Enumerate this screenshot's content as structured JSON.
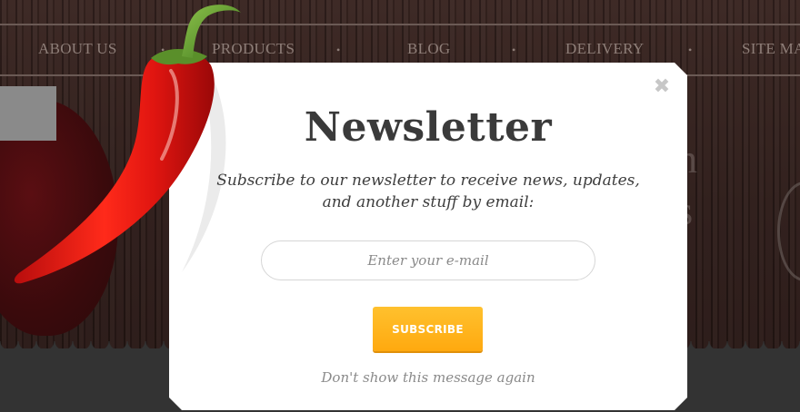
{
  "nav": {
    "items": [
      "ABOUT US",
      "PRODUCTS",
      "BLOG",
      "DELIVERY",
      "SITE MA"
    ]
  },
  "background": {
    "ghost_1": "n",
    "ghost_2": "s"
  },
  "popup": {
    "title": "Newsletter",
    "description_line1": "Subscribe to our newsletter to receive news, updates,",
    "description_line2": "and another stuff by email:",
    "email_placeholder": "Enter your e-mail",
    "email_value": "",
    "subscribe_label": "SUBSCRIBE",
    "dont_show_label": "Don't show this message again",
    "close_glyph": "✖"
  },
  "icons": {
    "close": "close-icon",
    "chili": "chili-pepper-illustration"
  },
  "colors": {
    "accent": "#ffb11d",
    "modal_bg": "#ffffff",
    "title": "#3a3a3a",
    "muted": "#8a8a8a",
    "background": "#2a1a17"
  }
}
